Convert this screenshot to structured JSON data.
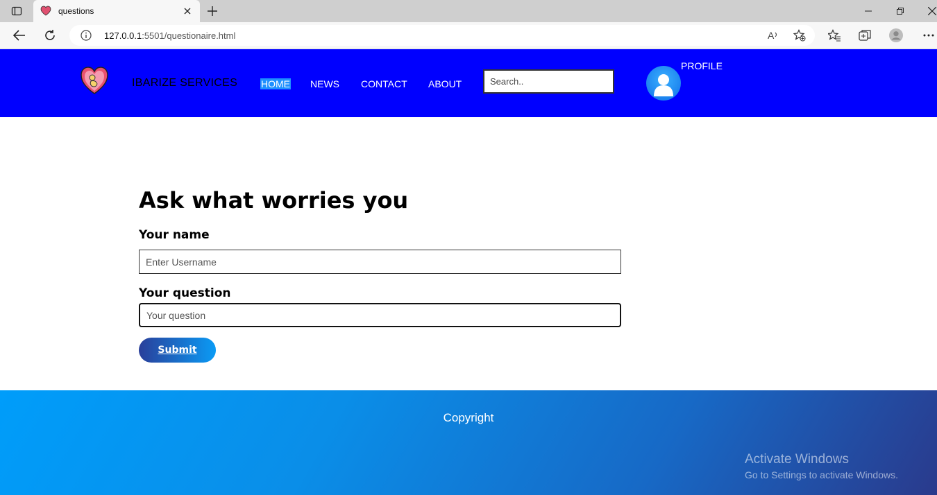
{
  "browser": {
    "tab_title": "questions",
    "url_host": "127.0.0.1",
    "url_path": ":5501/questionaire.html"
  },
  "header": {
    "brand": "IBARIZE SERVICES",
    "nav": [
      "HOME",
      "NEWS",
      "CONTACT",
      "ABOUT"
    ],
    "active_nav": "HOME",
    "search_placeholder": "Search..",
    "profile_label": "PROFILE",
    "background_color": "#0000ff"
  },
  "form": {
    "title": "Ask what worries you",
    "name_label": "Your name",
    "name_placeholder": "Enter Username",
    "question_label": "Your question",
    "question_placeholder": "Your question",
    "submit_label": "Submit"
  },
  "footer": {
    "copyright": "Copyright"
  },
  "watermark": {
    "title": "Activate Windows",
    "subtitle": "Go to Settings to activate Windows."
  }
}
